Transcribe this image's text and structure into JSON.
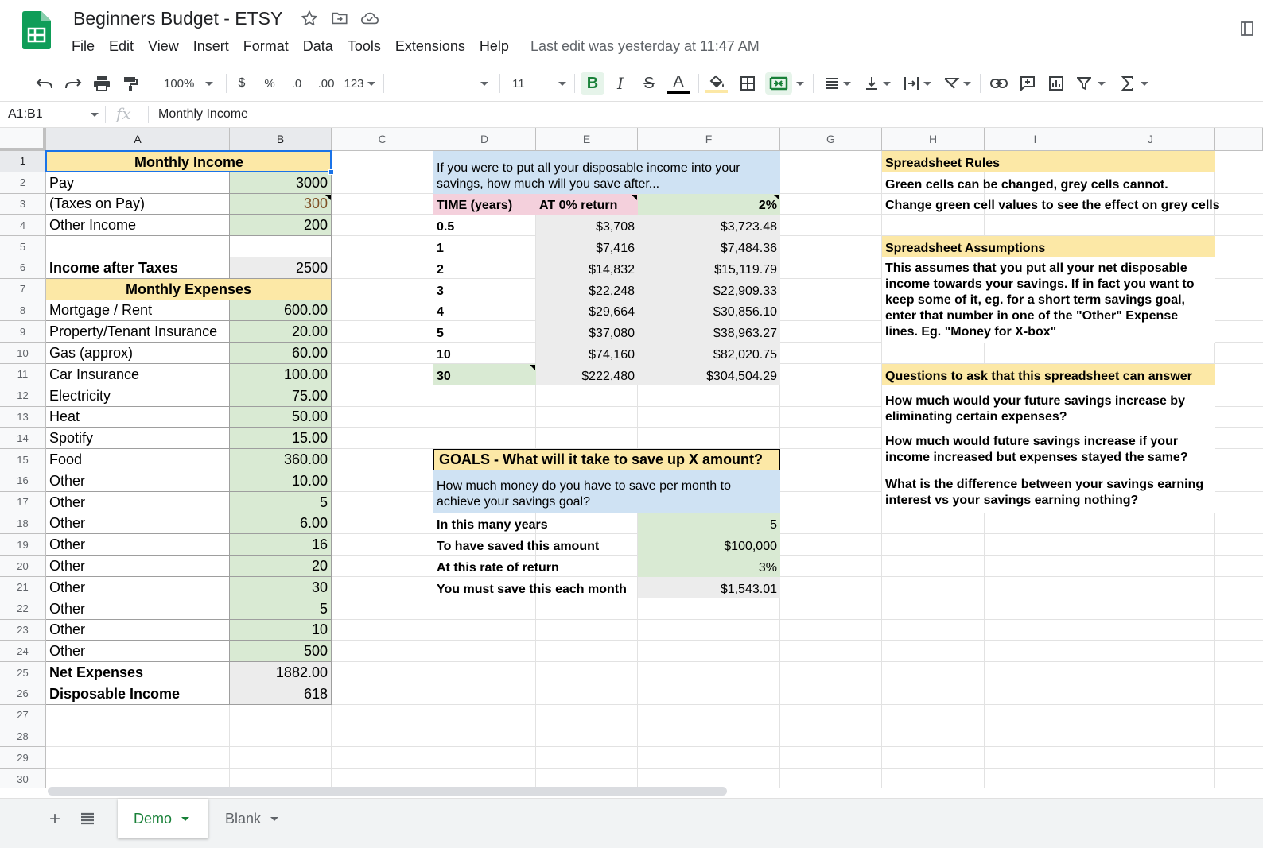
{
  "app": {
    "doc_title": "Beginners Budget - ETSY",
    "menu": [
      "File",
      "Edit",
      "View",
      "Insert",
      "Format",
      "Data",
      "Tools",
      "Extensions",
      "Help"
    ],
    "last_edit": "Last edit was yesterday at 11:47 AM"
  },
  "toolbar": {
    "zoom": "100%",
    "currency": "$",
    "percent": "%",
    "decrease_decimal": ".0",
    "increase_decimal": ".00",
    "more_formats": "123",
    "font_size": "11",
    "bold": "B",
    "italic": "I",
    "strike": "S",
    "text_color": "A",
    "icons": [
      "undo-icon",
      "redo-icon",
      "print-icon",
      "paint-format-icon",
      "fill-color-icon",
      "borders-icon",
      "merge-cells-icon",
      "align-icon",
      "valign-icon",
      "text-wrap-icon",
      "text-rotate-icon",
      "link-icon",
      "comment-icon",
      "chart-icon",
      "filter-icon",
      "functions-icon"
    ]
  },
  "formula_bar": {
    "name_box": "A1:B1",
    "fx": "fx",
    "value": "Monthly Income"
  },
  "columns": [
    "A",
    "B",
    "C",
    "D",
    "E",
    "F",
    "G",
    "H",
    "I",
    "J"
  ],
  "rows": [
    "1",
    "2",
    "3",
    "4",
    "5",
    "6",
    "7",
    "8",
    "9",
    "10",
    "11",
    "12",
    "13",
    "14",
    "15",
    "16",
    "17",
    "18",
    "19",
    "20",
    "21",
    "22",
    "23",
    "24",
    "25",
    "26",
    "27",
    "28",
    "29",
    "30"
  ],
  "budget": {
    "income_header": "Monthly Income",
    "income": [
      {
        "label": "Pay",
        "value": "3000"
      },
      {
        "label": "(Taxes on Pay)",
        "value": "300"
      },
      {
        "label": "Other Income",
        "value": "200"
      }
    ],
    "income_after_taxes": {
      "label": "Income after Taxes",
      "value": "2500"
    },
    "expenses_header": "Monthly Expenses",
    "expenses": [
      {
        "label": "Mortgage / Rent",
        "value": "600.00"
      },
      {
        "label": "Property/Tenant Insurance",
        "value": "20.00"
      },
      {
        "label": "Gas (approx)",
        "value": "60.00"
      },
      {
        "label": "Car Insurance",
        "value": "100.00"
      },
      {
        "label": "Electricity",
        "value": "75.00"
      },
      {
        "label": "Heat",
        "value": "50.00"
      },
      {
        "label": "Spotify",
        "value": "15.00"
      },
      {
        "label": "Food",
        "value": "360.00"
      },
      {
        "label": "Other",
        "value": "10.00"
      },
      {
        "label": "Other",
        "value": "5"
      },
      {
        "label": "Other",
        "value": "6.00"
      },
      {
        "label": "Other",
        "value": "16"
      },
      {
        "label": "Other",
        "value": "20"
      },
      {
        "label": "Other",
        "value": "30"
      },
      {
        "label": "Other",
        "value": "5"
      },
      {
        "label": "Other",
        "value": "10"
      },
      {
        "label": "Other",
        "value": "500"
      }
    ],
    "net_expenses": {
      "label": "Net Expenses",
      "value": "1882.00"
    },
    "disposable_income": {
      "label": "Disposable Income",
      "value": "618"
    }
  },
  "savings": {
    "question": "If you were to put all your disposable income into your savings, how much will you save after...",
    "col_time": "TIME (years)",
    "col_zero": "AT 0% return",
    "col_rate": "2%",
    "rows": [
      {
        "time": "0.5",
        "zero": "$3,708",
        "rate": "$3,723.48"
      },
      {
        "time": "1",
        "zero": "$7,416",
        "rate": "$7,484.36"
      },
      {
        "time": "2",
        "zero": "$14,832",
        "rate": "$15,119.79"
      },
      {
        "time": "3",
        "zero": "$22,248",
        "rate": "$22,909.33"
      },
      {
        "time": "4",
        "zero": "$29,664",
        "rate": "$30,856.10"
      },
      {
        "time": "5",
        "zero": "$37,080",
        "rate": "$38,963.27"
      },
      {
        "time": "10",
        "zero": "$74,160",
        "rate": "$82,020.75"
      },
      {
        "time": "30",
        "zero": "$222,480",
        "rate": "$304,504.29"
      }
    ]
  },
  "goals": {
    "header": "GOALS - What will it take to save up X amount?",
    "question": "How much money do you have to save per month to achieve your savings goal?",
    "rows": [
      {
        "label": "In this many years",
        "value": "5"
      },
      {
        "label": "To have saved this amount",
        "value": "$100,000"
      },
      {
        "label": "At this rate of return",
        "value": "3%"
      },
      {
        "label": "You must save this each month",
        "value": "$1,543.01"
      }
    ]
  },
  "notes": {
    "rules_header": "Spreadsheet Rules",
    "rules_1": "Green cells can be changed, grey cells cannot.",
    "rules_2": "Change green cell values to see the effect on grey cells",
    "assumptions_header": "Spreadsheet Assumptions",
    "assumptions_text": "This assumes that you put all your net disposable income towards your savings. If in fact you want to keep some of it, eg. for a short term savings goal, enter that number in one of the \"Other\" Expense lines. Eg. \"Money for X-box\"",
    "questions_header": "Questions to ask that this spreadsheet can answer",
    "q1": "How much would your future savings increase by eliminating certain expenses?",
    "q2": "How much would future savings increase if your income increased but expenses stayed the same?",
    "q3": "What is the difference between your savings earning interest vs your savings earning nothing?"
  },
  "sheets": {
    "add": "+",
    "tabs": [
      "Demo",
      "Blank"
    ],
    "active": "Demo"
  },
  "colors": {
    "yellow": "#fce8a6",
    "green": "#d9ead3",
    "grey": "#ececec",
    "blue": "#cfe2f3",
    "pink": "#f4d0dc",
    "selection": "#1a73e8",
    "sheets_green": "#188038"
  }
}
